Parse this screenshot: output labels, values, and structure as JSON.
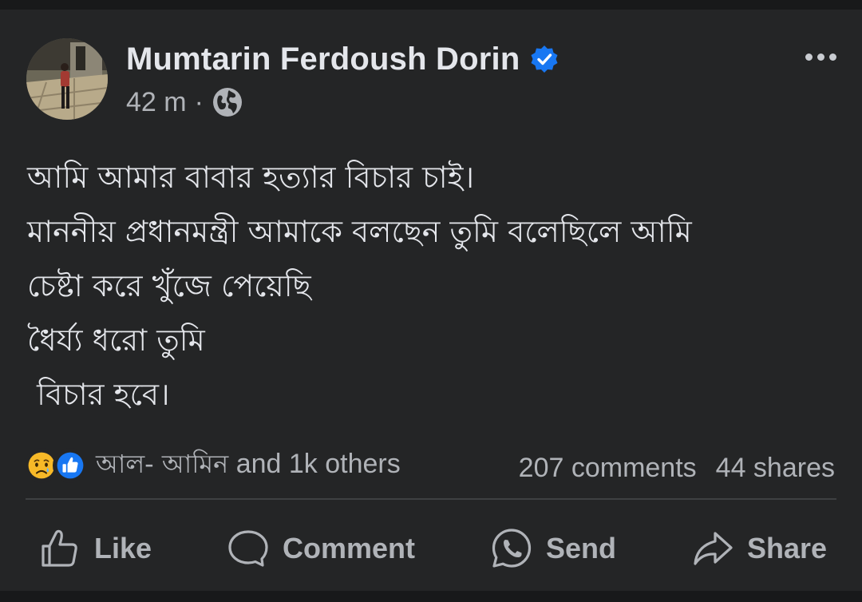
{
  "post": {
    "author": "Mumtarin Ferdoush Dorin",
    "time": "42 m",
    "separator": "·",
    "audience_icon": "globe-icon",
    "verified_icon": "verified-badge-icon",
    "more_icon": "more-options-icon",
    "lines": [
      "আমি আমার বাবার হত্যার বিচার চাই।",
      "মাননীয় প্রধানমন্ত্রী আমাকে বলছেন তুমি বলেছিলে আমি",
      "চেষ্টা করে খুঁজে পেয়েছি",
      "ধৈর্য্য ধরো তুমি",
      " বিচার হবে।"
    ]
  },
  "engagement": {
    "reaction_icons": [
      "sad-reaction-icon",
      "like-reaction-icon"
    ],
    "reacted_by": "আল- আমিন",
    "reacted_others": " and 1k others",
    "comments": "207 comments",
    "shares": "44 shares"
  },
  "actions": {
    "like": "Like",
    "comment": "Comment",
    "send": "Send",
    "share": "Share"
  },
  "colors": {
    "background": "#18191a",
    "card": "#242526",
    "primary_text": "#e4e6eb",
    "secondary_text": "#b0b3b8",
    "verified_blue": "#1877f2",
    "sad_yellow": "#f7b928"
  }
}
